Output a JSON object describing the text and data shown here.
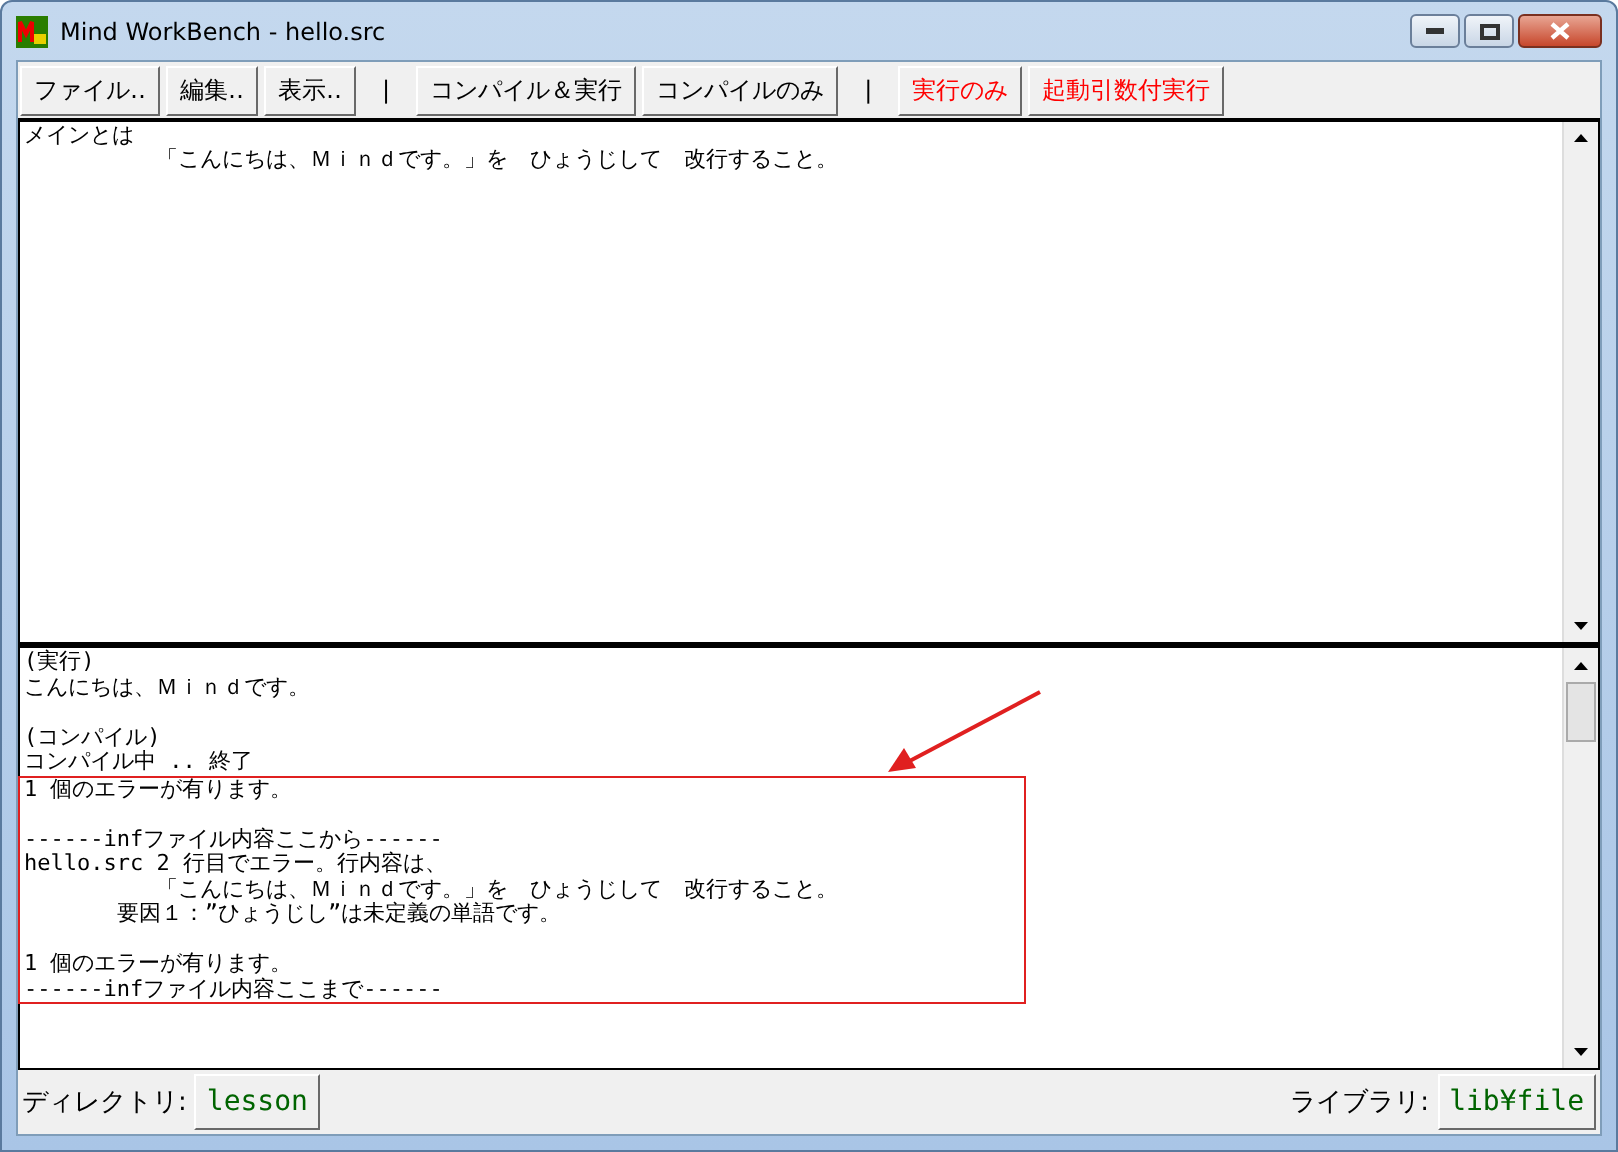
{
  "window": {
    "title": "Mind WorkBench - hello.src"
  },
  "toolbar": [
    {
      "kind": "button",
      "label": "ファイル‥",
      "color": "#000000"
    },
    {
      "kind": "button",
      "label": "編集‥",
      "color": "#000000"
    },
    {
      "kind": "button",
      "label": "表示‥",
      "color": "#000000"
    },
    {
      "kind": "separator",
      "label": "|"
    },
    {
      "kind": "button",
      "label": "コンパイル＆実行",
      "color": "#000000"
    },
    {
      "kind": "button",
      "label": "コンパイルのみ",
      "color": "#000000"
    },
    {
      "kind": "separator",
      "label": "|"
    },
    {
      "kind": "button",
      "label": "実行のみ",
      "color": "#ff0000"
    },
    {
      "kind": "button",
      "label": "起動引数付実行",
      "color": "#ff0000"
    }
  ],
  "editor": {
    "lines": [
      "メインとは",
      "          「こんにちは、Ｍｉｎｄです。」を　ひょうじして　改行すること。"
    ]
  },
  "output": {
    "blocks": [
      [
        "(実行)",
        "こんにちは、Ｍｉｎｄです。"
      ],
      [
        "(コンパイル)",
        "コンパイル中 .. 終了"
      ]
    ],
    "highlight_box": {
      "blocks": [
        [
          "1 個のエラーが有ります。"
        ],
        [
          "------infファイル内容ここから------",
          "hello.src 2 行目でエラー。行内容は、",
          "          「こんにちは、Ｍｉｎｄです。」を　ひょうじして　改行すること。",
          "       要因１：”ひょうじし”は未定義の単語です。"
        ],
        [
          "1 個のエラーが有ります。",
          "------infファイル内容ここまで------"
        ]
      ]
    }
  },
  "bottom_bar": {
    "directory_label": "ディレクトリ:",
    "directory_button": "lesson",
    "library_label": "ライブラリ:",
    "library_button": "lib¥file"
  }
}
